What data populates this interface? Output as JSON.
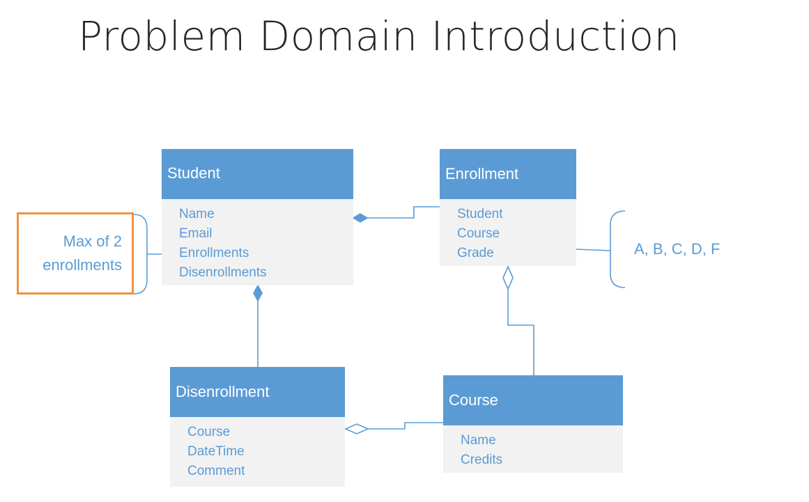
{
  "slide": {
    "title": "Problem Domain Introduction"
  },
  "entities": {
    "student": {
      "name": "Student",
      "attributes": [
        "Name",
        "Email",
        "Enrollments",
        "Disenrollments"
      ]
    },
    "enrollment": {
      "name": "Enrollment",
      "attributes": [
        "Student",
        "Course",
        "Grade"
      ]
    },
    "disenrollment": {
      "name": "Disenrollment",
      "attributes": [
        "Course",
        "DateTime",
        "Comment"
      ]
    },
    "course": {
      "name": "Course",
      "attributes": [
        "Name",
        "Credits"
      ]
    }
  },
  "annotations": {
    "max_enrollments_line1": "Max of 2",
    "max_enrollments_line2": "enrollments",
    "grades": "A, B, C, D, F"
  },
  "colors": {
    "entity_header": "#5b9bd5",
    "entity_body": "#f2f2f2",
    "text_blue": "#5b9bd5",
    "highlight_border": "#f0933a",
    "title_text": "#262626"
  }
}
